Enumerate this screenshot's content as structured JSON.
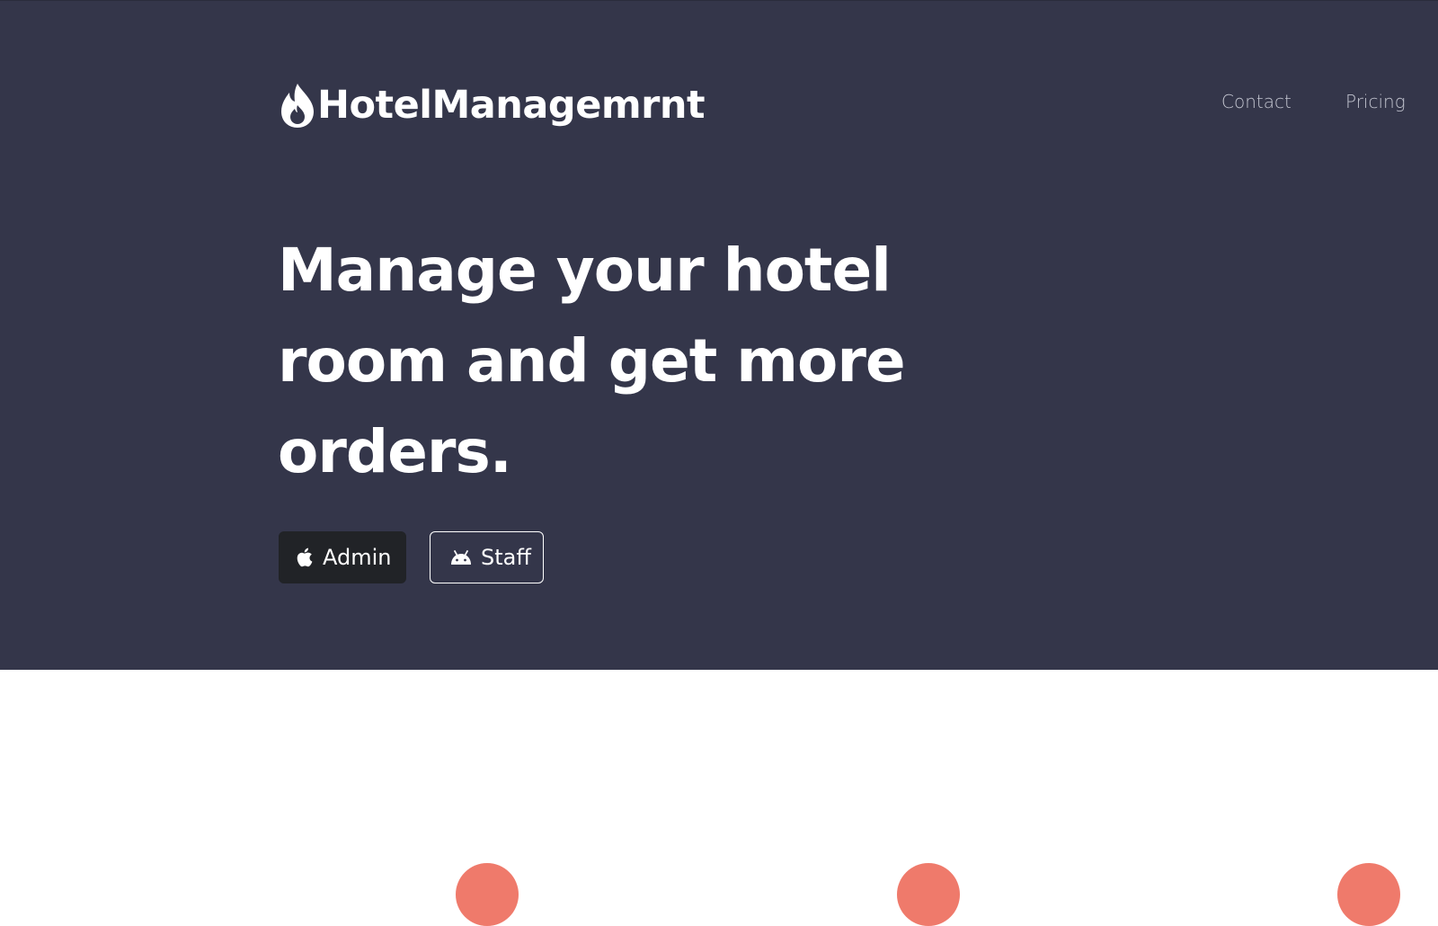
{
  "brand": {
    "name": "HotelManagemrnt",
    "icon": "flame-icon"
  },
  "nav": {
    "links": [
      {
        "label": "Contact"
      },
      {
        "label": "Pricing"
      }
    ]
  },
  "hero": {
    "headline": "Manage your hotel room and get more orders.",
    "background": "#34364a",
    "buttons": [
      {
        "label": "Admin",
        "icon": "apple-icon"
      },
      {
        "label": "Staff",
        "icon": "android-icon"
      }
    ]
  },
  "features": {
    "accent": "#ef7a6b",
    "icons": [
      "feature-icon-1",
      "feature-icon-2",
      "feature-icon-3"
    ]
  }
}
